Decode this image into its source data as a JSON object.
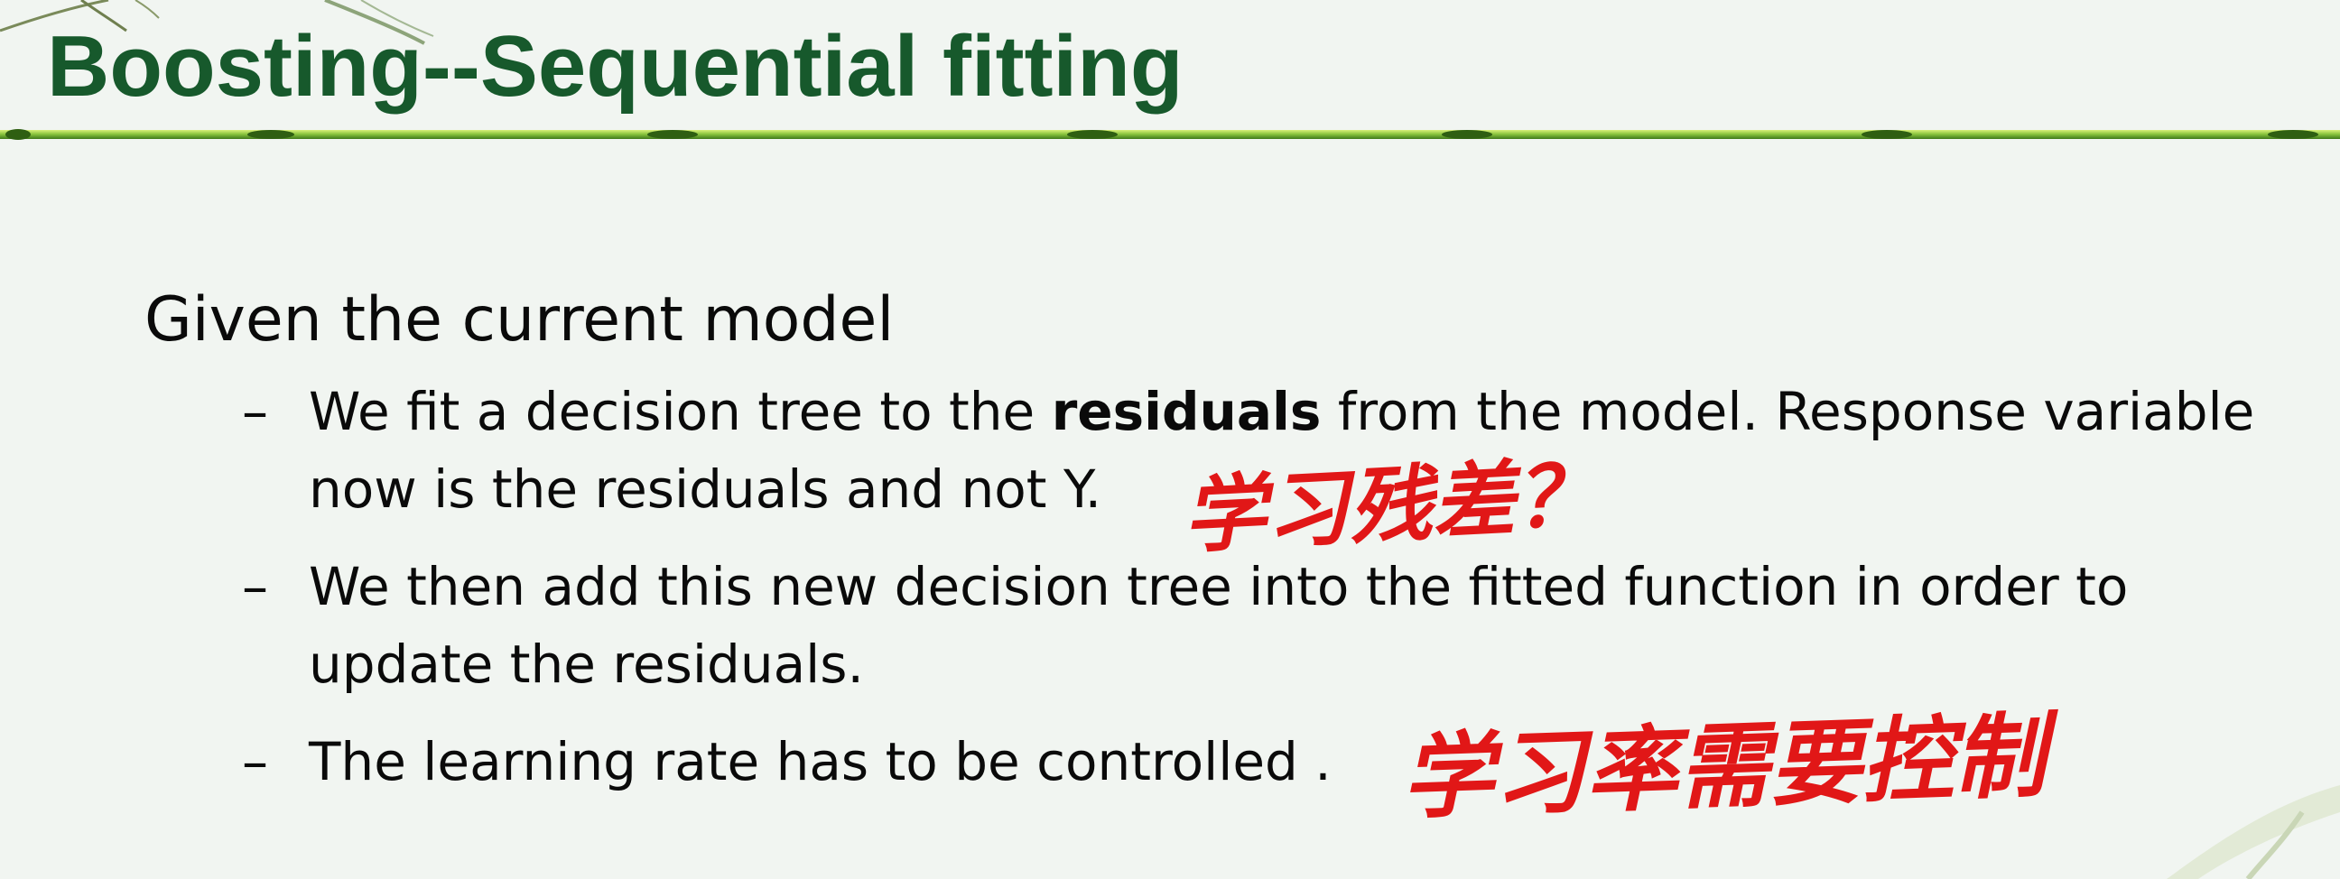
{
  "slide": {
    "title": "Boosting--Sequential fitting",
    "lead": "Given the current model",
    "bullets": [
      {
        "marker": "–",
        "line1_pre": "We fit a decision tree to the ",
        "line1_bold": "residuals",
        "line1_post": " from the model. Response variable",
        "line2": "now is the residuals and not Y."
      },
      {
        "marker": "–",
        "line1": "We then add this new decision tree into the fitted function in order to",
        "line2": "update the residuals."
      },
      {
        "marker": "–",
        "line1": "The learning rate has to be controlled ."
      }
    ],
    "handwritten_notes": [
      "学习残差？",
      "学习率需要控制"
    ]
  },
  "colors": {
    "background": "#f1f5f1",
    "title": "#17592c",
    "body_text": "#0a0a0a",
    "annotation": "#e11717",
    "rule": "#7fbf1f"
  }
}
